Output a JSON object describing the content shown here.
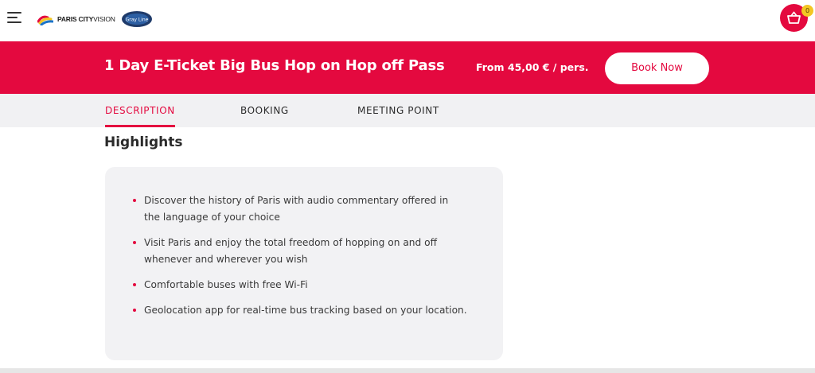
{
  "header": {
    "menu_icon": "hamburger-menu-icon",
    "logo": {
      "brand_bold": "PARIS CITY",
      "brand_light": "VISION",
      "badge_text": "Gray Line"
    },
    "cart": {
      "icon": "basket-icon",
      "count": "0"
    }
  },
  "banner": {
    "title": "1 Day E-Ticket Big Bus Hop on Hop off Pass",
    "price": "From 45,00 € / pers.",
    "book_label": "Book Now"
  },
  "tabs": [
    {
      "label": "DESCRIPTION",
      "active": true
    },
    {
      "label": "BOOKING",
      "active": false
    },
    {
      "label": "MEETING POINT",
      "active": false
    }
  ],
  "highlights": {
    "title": "Highlights",
    "items": [
      "Discover the history of Paris with audio commentary offered in the language of your choice",
      "Visit Paris and enjoy the  total freedom of hopping on and off whenever and wherever  you wish",
      "Comfortable buses with free Wi-Fi",
      "Geolocation app for real-time bus tracking based on your location."
    ]
  },
  "colors": {
    "accent": "#e4093f",
    "tab_bar": "#f1f1f3",
    "card_bg": "#f2f2f4",
    "cart_badge": "#f3c623"
  }
}
